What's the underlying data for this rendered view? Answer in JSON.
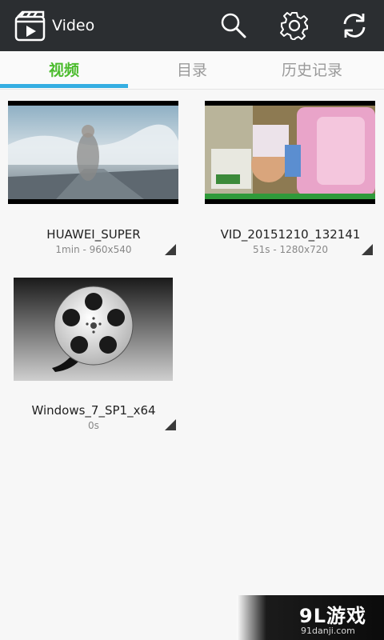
{
  "appbar": {
    "title": "Video",
    "icons": {
      "app": "video-clapper-icon",
      "search": "search-icon",
      "settings": "gear-icon",
      "refresh": "refresh-icon"
    }
  },
  "tabs": [
    {
      "label": "视频",
      "active": true
    },
    {
      "label": "目录",
      "active": false
    },
    {
      "label": "历史记录",
      "active": false
    }
  ],
  "videos": [
    {
      "name": "HUAWEI_SUPER",
      "meta": "1min - 960x540"
    },
    {
      "name": "VID_20151210_132141",
      "meta": "51s - 1280x720"
    },
    {
      "name": "Windows_7_SP1_x64",
      "meta": "0s"
    }
  ],
  "watermark": {
    "brand": "9L游戏",
    "url": "91danji.com"
  },
  "colors": {
    "appbar": "#2b2e31",
    "tab_active": "#4cbc2e",
    "tab_indicator": "#35aee2"
  }
}
